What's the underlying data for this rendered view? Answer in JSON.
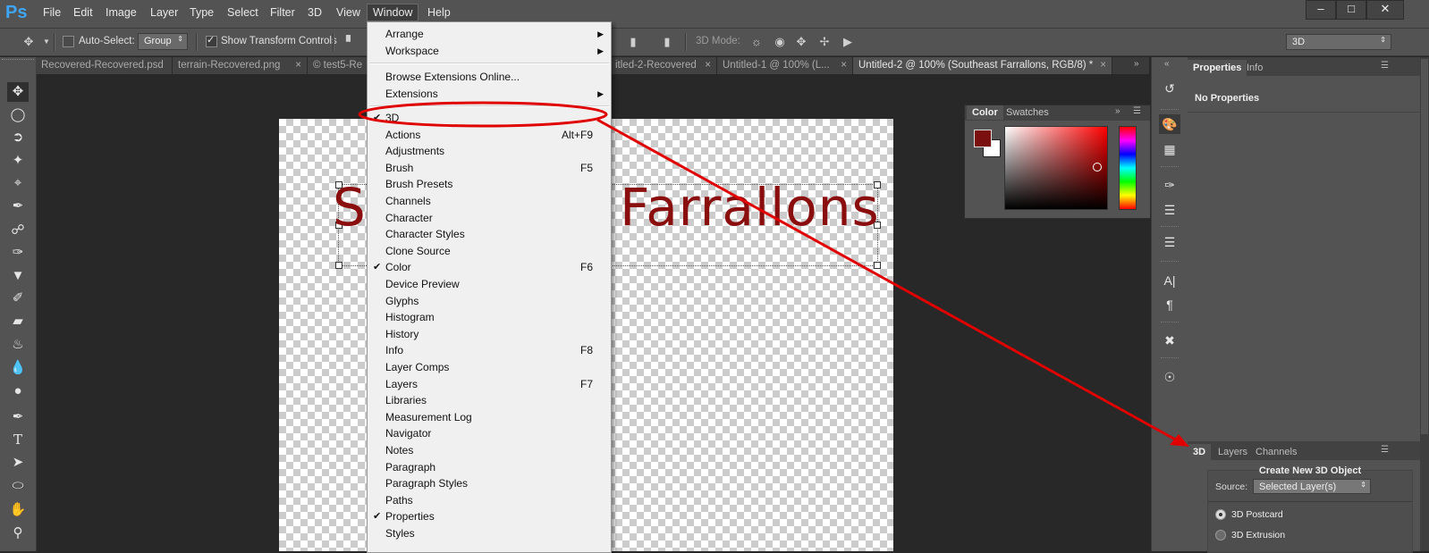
{
  "app": {
    "logo": "Ps"
  },
  "menubar": {
    "items": [
      "File",
      "Edit",
      "Image",
      "Layer",
      "Type",
      "Select",
      "Filter",
      "3D",
      "View",
      "Window",
      "Help"
    ],
    "window_controls": {
      "minimize": "–",
      "maximize": "□",
      "close": "✕"
    }
  },
  "options_bar": {
    "auto_select_label": "Auto-Select:",
    "auto_select_value": "Group",
    "show_transform_label": "Show Transform Controls",
    "mode_label": "3D Mode:",
    "workspace_value": "3D"
  },
  "tabs": [
    {
      "label": "Recovered-Recovered.psd"
    },
    {
      "label": "terrain-Recovered.png"
    },
    {
      "label": "© test5-Re"
    },
    {
      "label": "itled-2-Recovered"
    },
    {
      "label": "Untitled-1 @ 100% (L..."
    },
    {
      "label": "Untitled-2 @ 100% (Southeast Farrallons, RGB/8) *"
    }
  ],
  "canvas": {
    "text": "Southeast Farrallons",
    "text_color": "#8b0e0e"
  },
  "window_menu": {
    "items_top": [
      {
        "label": "Arrange",
        "submenu": true
      },
      {
        "label": "Workspace",
        "submenu": true
      }
    ],
    "items_ext": [
      {
        "label": "Browse Extensions Online..."
      },
      {
        "label": "Extensions",
        "submenu": true
      }
    ],
    "panels": [
      {
        "label": "3D",
        "checked": true,
        "shortcut": ""
      },
      {
        "label": "Actions",
        "checked": false,
        "shortcut": "Alt+F9"
      },
      {
        "label": "Adjustments",
        "checked": false,
        "shortcut": ""
      },
      {
        "label": "Brush",
        "checked": false,
        "shortcut": "F5"
      },
      {
        "label": "Brush Presets",
        "checked": false,
        "shortcut": ""
      },
      {
        "label": "Channels",
        "checked": false,
        "shortcut": ""
      },
      {
        "label": "Character",
        "checked": false,
        "shortcut": ""
      },
      {
        "label": "Character Styles",
        "checked": false,
        "shortcut": ""
      },
      {
        "label": "Clone Source",
        "checked": false,
        "shortcut": ""
      },
      {
        "label": "Color",
        "checked": true,
        "shortcut": "F6"
      },
      {
        "label": "Device Preview",
        "checked": false,
        "shortcut": ""
      },
      {
        "label": "Glyphs",
        "checked": false,
        "shortcut": ""
      },
      {
        "label": "Histogram",
        "checked": false,
        "shortcut": ""
      },
      {
        "label": "History",
        "checked": false,
        "shortcut": ""
      },
      {
        "label": "Info",
        "checked": false,
        "shortcut": "F8"
      },
      {
        "label": "Layer Comps",
        "checked": false,
        "shortcut": ""
      },
      {
        "label": "Layers",
        "checked": false,
        "shortcut": "F7"
      },
      {
        "label": "Libraries",
        "checked": false,
        "shortcut": ""
      },
      {
        "label": "Measurement Log",
        "checked": false,
        "shortcut": ""
      },
      {
        "label": "Navigator",
        "checked": false,
        "shortcut": ""
      },
      {
        "label": "Notes",
        "checked": false,
        "shortcut": ""
      },
      {
        "label": "Paragraph",
        "checked": false,
        "shortcut": ""
      },
      {
        "label": "Paragraph Styles",
        "checked": false,
        "shortcut": ""
      },
      {
        "label": "Paths",
        "checked": false,
        "shortcut": ""
      },
      {
        "label": "Properties",
        "checked": true,
        "shortcut": ""
      },
      {
        "label": "Styles",
        "checked": false,
        "shortcut": ""
      }
    ]
  },
  "color_panel": {
    "tabs": [
      "Color",
      "Swatches"
    ],
    "foreground": "#7a1010",
    "background": "#ffffff"
  },
  "properties_panel": {
    "tabs": [
      "Properties",
      "Info"
    ],
    "status": "No Properties"
  },
  "panel_3d": {
    "tabs": [
      "3D",
      "Layers",
      "Channels"
    ],
    "title": "Create New 3D Object",
    "source_label": "Source:",
    "source_value": "Selected Layer(s)",
    "options": [
      "3D Postcard",
      "3D Extrusion"
    ],
    "selected_option": "3D Postcard"
  },
  "annotation": {
    "color": "#e00000"
  },
  "tools": [
    "move-tool",
    "marquee-tool",
    "lasso-tool",
    "magic-wand-tool",
    "crop-tool",
    "eyedropper-tool",
    "healing-brush-tool",
    "brush-tool",
    "clone-stamp-tool",
    "history-brush-tool",
    "eraser-tool",
    "paint-bucket-tool",
    "blur-tool",
    "dodge-tool",
    "pen-tool",
    "type-tool",
    "path-selection-tool",
    "ellipse-tool",
    "hand-tool",
    "zoom-tool"
  ]
}
